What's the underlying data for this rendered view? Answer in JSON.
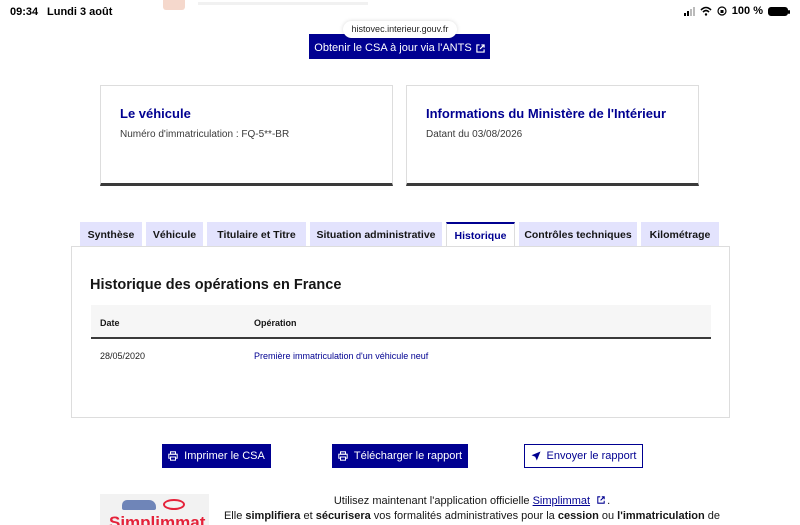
{
  "status_bar": {
    "time": "09:34",
    "date": "Lundi 3 août",
    "battery": "100 %",
    "icons": [
      "signal-icon",
      "wifi-icon",
      "orientation-lock-icon",
      "battery-icon"
    ]
  },
  "browser": {
    "url": "histovec.interieur.gouv.fr"
  },
  "csa_button": {
    "label": "Obtenir le CSA à jour via l'ANTS",
    "icon": "external-link-icon"
  },
  "cards": [
    {
      "title": "Le véhicule",
      "text": "Numéro d'immatriculation : FQ-5**-BR"
    },
    {
      "title": "Informations du Ministère de l'Intérieur",
      "text": "Datant du 03/08/2026"
    }
  ],
  "tabs": [
    {
      "label": "Synthèse",
      "active": false
    },
    {
      "label": "Véhicule",
      "active": false
    },
    {
      "label": "Titulaire et Titre",
      "active": false
    },
    {
      "label": "Situation administrative",
      "active": false
    },
    {
      "label": "Historique",
      "active": true
    },
    {
      "label": "Contrôles techniques",
      "active": false
    },
    {
      "label": "Kilométrage",
      "active": false
    }
  ],
  "history": {
    "title": "Historique des opérations en France",
    "columns": [
      "Date",
      "Opération"
    ],
    "rows": [
      {
        "date": "28/05/2020",
        "operation": "Première immatriculation d'un véhicule neuf"
      }
    ]
  },
  "actions": {
    "print": "Imprimer le CSA",
    "download": "Télécharger le rapport",
    "send": "Envoyer le rapport"
  },
  "promo": {
    "logo_text": "Simplimmat",
    "line1_before": "Utilisez maintenant l'application officielle ",
    "line1_link": "Simplimmat",
    "line1_after": ".",
    "line2_a": "Elle ",
    "line2_b": "simplifiera",
    "line2_c": " et ",
    "line2_d": "sécurisera",
    "line2_e": " vos formalités administratives pour la ",
    "line2_f": "cession",
    "line2_g": " ou ",
    "line2_h": "l'immatriculation",
    "line2_i": " de"
  },
  "colors": {
    "primary": "#000091",
    "tab_inactive_bg": "#e3e3fd",
    "brand_red": "#e5223a"
  }
}
